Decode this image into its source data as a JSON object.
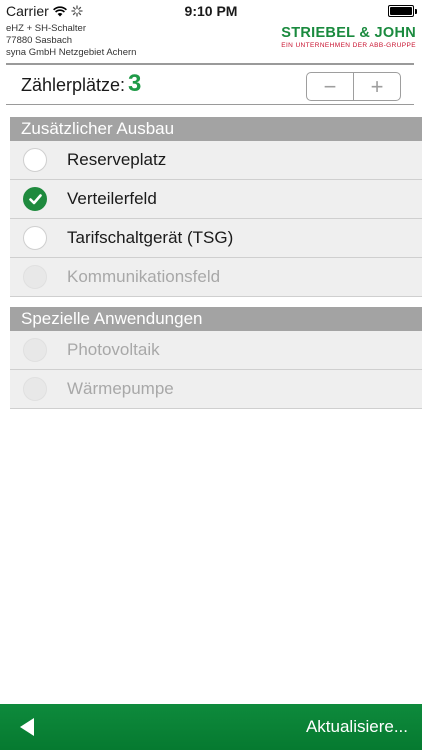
{
  "status_bar": {
    "carrier": "Carrier",
    "time": "9:10 PM"
  },
  "header": {
    "info_lines": [
      "eHZ + SH-Schalter",
      "77880 Sasbach",
      "syna GmbH Netzgebiet Achern"
    ],
    "logo_brand": "STRIEBEL & JOHN",
    "logo_subtitle": "EIN UNTERNEHMEN DER ABB-GRUPPE"
  },
  "counter": {
    "label": "Zählerplätze:",
    "value": "3",
    "minus": "−",
    "plus": "+"
  },
  "sections": [
    {
      "title": "Zusätzlicher Ausbau",
      "items": [
        {
          "label": "Reserveplatz",
          "state": "unchecked"
        },
        {
          "label": "Verteilerfeld",
          "state": "checked"
        },
        {
          "label": "Tarifschaltgerät (TSG)",
          "state": "unchecked"
        },
        {
          "label": "Kommunikationsfeld",
          "state": "disabled"
        }
      ]
    },
    {
      "title": "Spezielle Anwendungen",
      "items": [
        {
          "label": "Photovoltaik",
          "state": "disabled"
        },
        {
          "label": "Wärmepumpe",
          "state": "disabled"
        }
      ]
    }
  ],
  "bottom_bar": {
    "update_label": "Aktualisiere..."
  },
  "colors": {
    "accent_green": "#1f9a47",
    "bar_green": "#0e8a3c",
    "logo_red": "#c8102e",
    "section_gray": "#a3a3a3"
  }
}
